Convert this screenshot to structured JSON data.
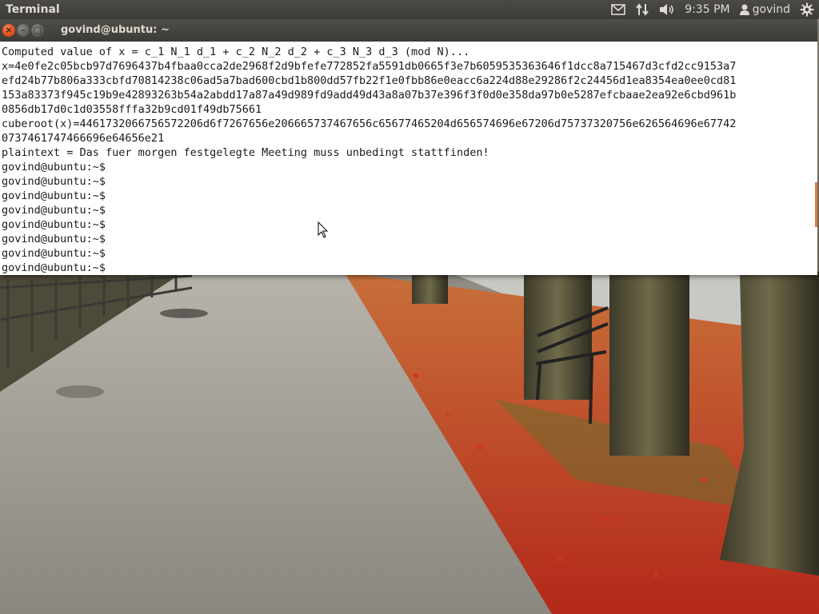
{
  "panel": {
    "app_name": "Terminal",
    "clock": "9:35 PM",
    "user": "govind",
    "icons": [
      "mail-icon",
      "network-transfer-icon",
      "volume-icon",
      "user-icon",
      "gear-icon"
    ]
  },
  "window": {
    "title": "govind@ubuntu: ~",
    "close_glyph": "×",
    "minimize_glyph": "–",
    "maximize_glyph": "□"
  },
  "terminal": {
    "lines": [
      "Computed value of x = c_1 N_1 d_1 + c_2 N_2 d_2 + c_3 N_3 d_3 (mod N)...",
      "x=4e0fe2c05bcb97d7696437b4fbaa0cca2de2968f2d9bfefe772852fa5591db0665f3e7b6059535363646f1dcc8a715467d3cfd2cc9153a7",
      "efd24b77b806a333cbfd70814238c06ad5a7bad600cbd1b800dd57fb22f1e0fbb86e0eacc6a224d88e29286f2c24456d1ea8354ea0ee0cd81",
      "153a83373f945c19b9e42893263b54a2abdd17a87a49d989fd9add49d43a8a07b37e396f3f0d0e358da97b0e5287efcbaae2ea92e6cbd961b",
      "0856db17d0c1d03558fffa32b9cd01f49db75661",
      "cuberoot(x)=4461732066756572206d6f7267656e206665737467656c65677465204d656574696e67206d75737320756e626564696e67742",
      "0737461747466696e64656e21",
      "plaintext = Das fuer morgen festgelegte Meeting muss unbedingt stattfinden!",
      "govind@ubuntu:~$",
      "govind@ubuntu:~$",
      "govind@ubuntu:~$",
      "govind@ubuntu:~$",
      "govind@ubuntu:~$",
      "govind@ubuntu:~$",
      "govind@ubuntu:~$",
      "govind@ubuntu:~$"
    ]
  },
  "colors": {
    "panel_bg": "#3c3b37",
    "close_button": "#dd4814",
    "scrollbar_thumb": "#e27a3f",
    "terminal_bg": "#ffffff"
  }
}
